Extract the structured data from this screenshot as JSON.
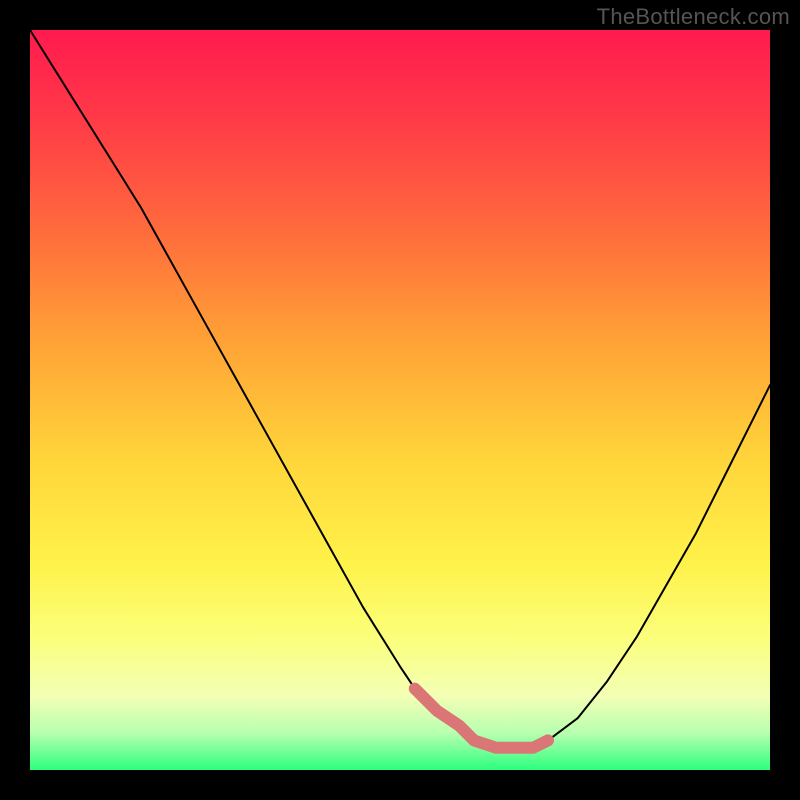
{
  "attribution": "TheBottleneck.com",
  "chart_data": {
    "type": "line",
    "title": "",
    "xlabel": "",
    "ylabel": "",
    "xlim": [
      0,
      100
    ],
    "ylim": [
      0,
      100
    ],
    "series": [
      {
        "name": "bottleneck-curve",
        "x": [
          0,
          5,
          10,
          15,
          20,
          25,
          30,
          35,
          40,
          45,
          50,
          52,
          55,
          58,
          60,
          63,
          66,
          68,
          70,
          74,
          78,
          82,
          86,
          90,
          94,
          100
        ],
        "y": [
          100,
          92,
          84,
          76,
          67,
          58,
          49,
          40,
          31,
          22,
          14,
          11,
          8,
          6,
          4,
          3,
          3,
          3,
          4,
          7,
          12,
          18,
          25,
          32,
          40,
          52
        ]
      }
    ],
    "highlight": {
      "name": "optimal-range",
      "x": [
        52,
        55,
        58,
        60,
        63,
        66,
        68,
        70
      ],
      "y": [
        11,
        8,
        6,
        4,
        3,
        3,
        3,
        4
      ]
    },
    "colors": {
      "curve": "#000000",
      "highlight": "#db7676",
      "gradient_top": "#ff1a4f",
      "gradient_bottom": "#2cff7e"
    }
  }
}
